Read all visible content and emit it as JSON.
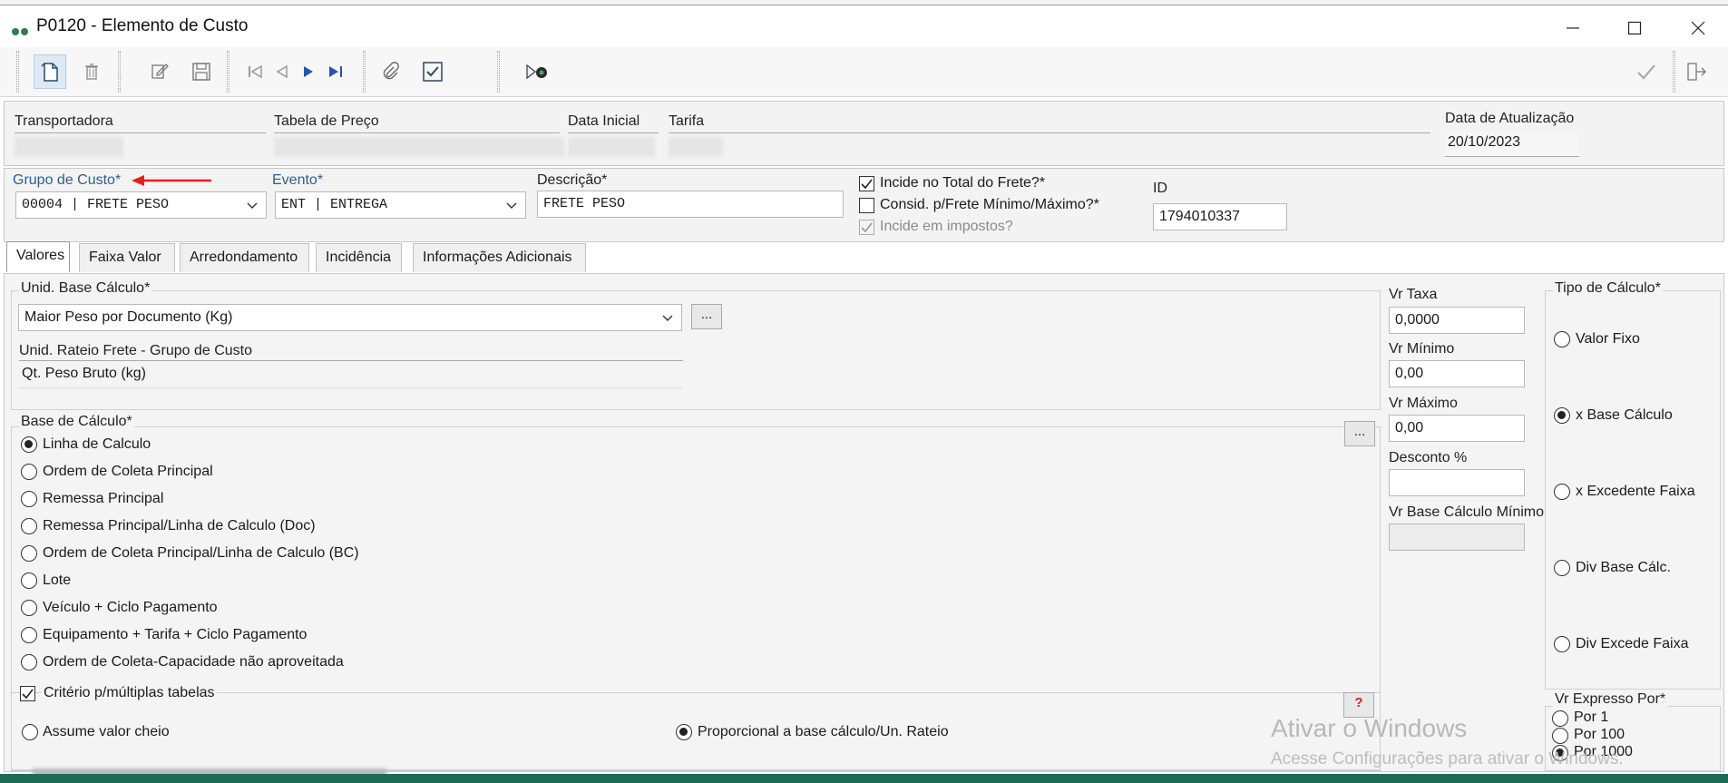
{
  "window": {
    "title": "P0120 - Elemento de Custo"
  },
  "header": {
    "transportadora_label": "Transportadora",
    "tabela_label": "Tabela de Preço",
    "data_inicial_label": "Data Inicial",
    "tarifa_label": "Tarifa",
    "data_atualizacao_label": "Data de Atualização",
    "data_atualizacao_value": "20/10/2023"
  },
  "form": {
    "grupo_label": "Grupo de Custo*",
    "grupo_value": "00004 | FRETE PESO",
    "evento_label": "Evento*",
    "evento_value": "ENT | ENTREGA",
    "descricao_label": "Descrição*",
    "descricao_value": "FRETE PESO",
    "incide_total_label": "Incide no Total do Frete?*",
    "incide_total_checked": true,
    "consid_label": "Consid. p/Frete Mínimo/Máximo?*",
    "consid_checked": false,
    "incide_impostos_label": "Incide em impostos?",
    "incide_impostos_checked": true,
    "id_label": "ID",
    "id_value": "1794010337"
  },
  "tabs": [
    {
      "label": "Valores",
      "active": true
    },
    {
      "label": "Faixa Valor",
      "active": false
    },
    {
      "label": "Arredondamento",
      "active": false
    },
    {
      "label": "Incidência",
      "active": false
    },
    {
      "label": "Informações Adicionais",
      "active": false
    }
  ],
  "valores": {
    "unid_base_label": "Unid. Base Cálculo*",
    "unid_base_value": "Maior Peso por Documento (Kg)",
    "ellipsis_label": "...",
    "unid_rateio_label": "Unid. Rateio Frete - Grupo de Custo",
    "unid_rateio_value": "Qt. Peso Bruto (kg)",
    "base_calculo_label": "Base de Cálculo*",
    "base_options": [
      {
        "label": "Linha de Calculo",
        "selected": true
      },
      {
        "label": "Ordem de Coleta Principal",
        "selected": false
      },
      {
        "label": "Remessa Principal",
        "selected": false
      },
      {
        "label": "Remessa Principal/Linha de Calculo (Doc)",
        "selected": false
      },
      {
        "label": "Ordem de Coleta Principal/Linha de Calculo (BC)",
        "selected": false
      },
      {
        "label": "Lote",
        "selected": false
      },
      {
        "label": "Veículo + Ciclo Pagamento",
        "selected": false
      },
      {
        "label": "Equipamento + Tarifa + Ciclo Pagamento",
        "selected": false
      },
      {
        "label": "Ordem de Coleta-Capacidade não aproveitada",
        "selected": false
      }
    ],
    "criterio_label": "Critério p/múltiplas tabelas",
    "criterio_checked": true,
    "assume_label": "Assume valor cheio",
    "proporcional_label": "Proporcional a base cálculo/Un. Rateio",
    "help_label": "?",
    "vr_taxa_label": "Vr Taxa",
    "vr_taxa_value": "0,0000",
    "vr_minimo_label": "Vr Mínimo",
    "vr_minimo_value": "0,00",
    "vr_maximo_label": "Vr Máximo",
    "vr_maximo_value": "0,00",
    "desconto_label": "Desconto %",
    "desconto_value": "",
    "vr_base_min_label": "Vr Base Cálculo Mínimo",
    "vr_base_min_value": "",
    "tipo_calculo_label": "Tipo de Cálculo*",
    "tipo_options": [
      {
        "label": "Valor Fixo",
        "selected": false
      },
      {
        "label": "x Base Cálculo",
        "selected": true
      },
      {
        "label": "x Excedente Faixa",
        "selected": false
      },
      {
        "label": "Div Base Cálc.",
        "selected": false
      },
      {
        "label": "Div Excede Faixa",
        "selected": false
      }
    ],
    "vr_expresso_label": "Vr Expresso Por*",
    "expresso_options": [
      {
        "label": "Por 1",
        "selected": false
      },
      {
        "label": "Por 100",
        "selected": false
      },
      {
        "label": "Por 1000",
        "selected": true
      }
    ]
  },
  "watermark": {
    "line1": "Ativar o Windows",
    "line2": "Acesse Configurações para ativar o Windows."
  },
  "colors": {
    "accent_green": "#1c6b57",
    "label_blue": "#2a5f8f",
    "arrow_red": "#e02020"
  }
}
